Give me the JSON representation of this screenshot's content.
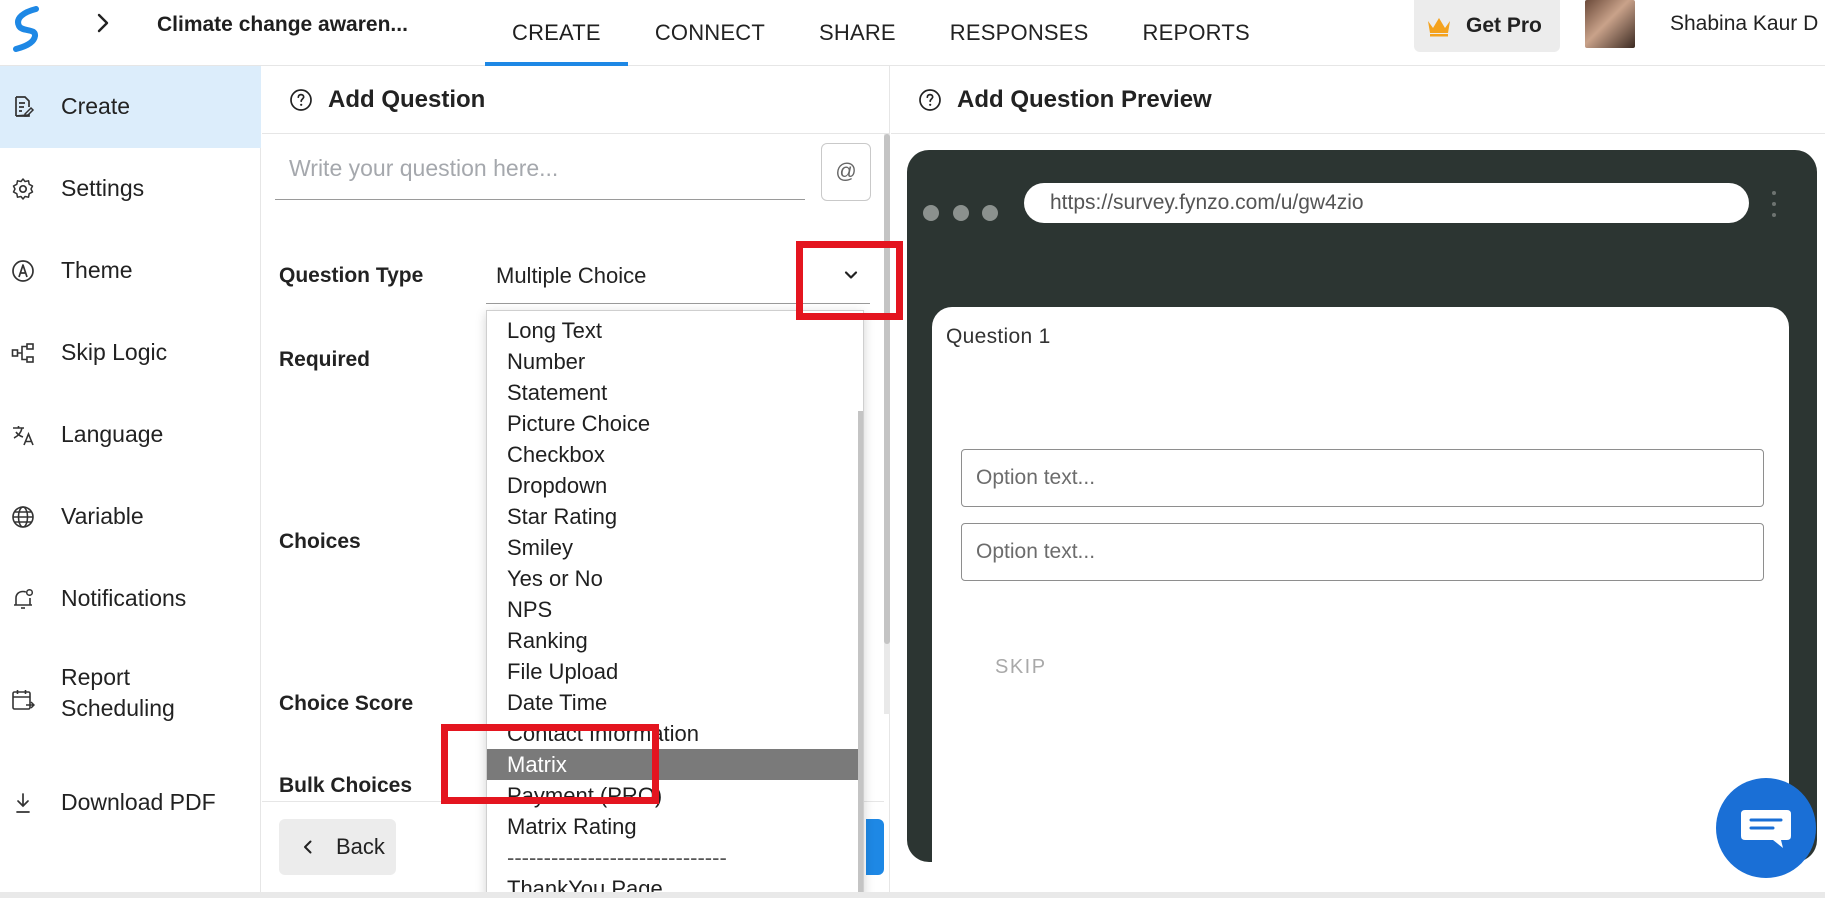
{
  "topbar": {
    "survey_title": "Climate change awaren...",
    "nav_tabs": [
      "CREATE",
      "CONNECT",
      "SHARE",
      "RESPONSES",
      "REPORTS"
    ],
    "active_tab": "CREATE",
    "get_pro_label": "Get Pro",
    "user_name": "Shabina Kaur D"
  },
  "sidebar": {
    "items": [
      {
        "label": "Create",
        "icon": "document-edit-icon"
      },
      {
        "label": "Settings",
        "icon": "gear-icon"
      },
      {
        "label": "Theme",
        "icon": "theme-icon"
      },
      {
        "label": "Skip Logic",
        "icon": "flow-icon"
      },
      {
        "label": "Language",
        "icon": "translate-icon"
      },
      {
        "label": "Variable",
        "icon": "globe-icon"
      },
      {
        "label": "Notifications",
        "icon": "bell-icon"
      },
      {
        "label": "Report Scheduling",
        "icon": "calendar-icon"
      },
      {
        "label": "Download PDF",
        "icon": "download-icon"
      }
    ]
  },
  "editor": {
    "title": "Add Question",
    "question_placeholder": "Write your question here...",
    "at_label": "@",
    "question_type_label": "Question Type",
    "question_type_value": "Multiple Choice",
    "required_label": "Required",
    "choices_label": "Choices",
    "choice_score_label": "Choice Score",
    "bulk_choices_label": "Bulk Choices",
    "back_label": "Back"
  },
  "dropdown": {
    "options": [
      "Long Text",
      "Number",
      "Statement",
      "Picture Choice",
      "Checkbox",
      "Dropdown",
      "Star Rating",
      "Smiley",
      "Yes or No",
      "NPS",
      "Ranking",
      "File Upload",
      "Date Time",
      "Contact Information",
      "Matrix",
      "Payment (PRO)",
      "Matrix Rating",
      "------------------------------",
      "ThankYou Page"
    ],
    "highlighted": "Matrix"
  },
  "preview": {
    "title": "Add Question Preview",
    "url": "https://survey.fynzo.com/u/gw4zio",
    "question_label": "Question 1",
    "option_placeholder_1": "Option text...",
    "option_placeholder_2": "Option text...",
    "skip_label": "SKIP"
  },
  "colors": {
    "accent": "#1e88e5",
    "sidebar_active_bg": "#dcedfb",
    "device_frame": "#2c3532",
    "highlight_row": "#7a7a7a",
    "annotation": "#e4151f",
    "chat_button": "#1a6fd6",
    "crown": "#f4a21d"
  }
}
